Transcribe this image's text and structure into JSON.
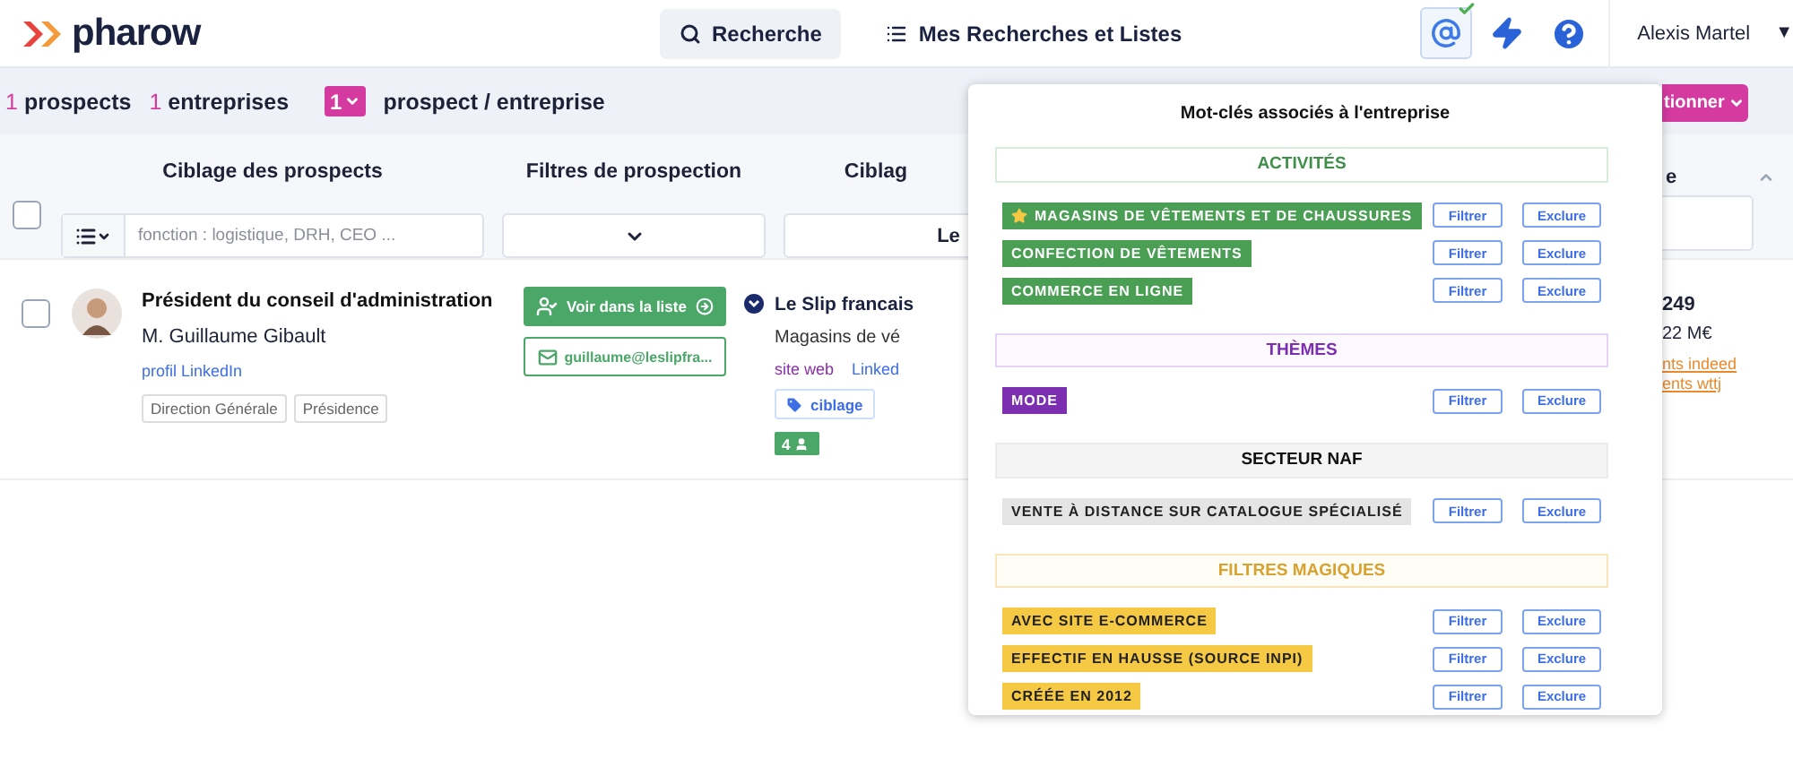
{
  "header": {
    "logo": "pharow",
    "nav": [
      {
        "label": "Recherche",
        "selected": true,
        "kind": "search"
      },
      {
        "label": "Mes Recherches et Listes",
        "selected": false,
        "kind": "list"
      }
    ],
    "user": "Alexis Martel",
    "user_caret": "▼"
  },
  "stats": {
    "counts": [
      {
        "count": "1",
        "label": "prospects"
      },
      {
        "count": "1",
        "label": "entreprises"
      }
    ],
    "per_company": {
      "value": "1",
      "label": "prospect / entreprise"
    },
    "action_button": "tionner"
  },
  "filters": {
    "select_all_checked": false,
    "columns": [
      {
        "title": "Ciblage des prospects",
        "kind": "text",
        "placeholder": "fonction : logistique, DRH, CEO ..."
      },
      {
        "title": "Filtres de prospection",
        "kind": "select"
      },
      {
        "title": "Ciblag",
        "kind": "partial",
        "value": "Le"
      }
    ],
    "right_column_title": "e"
  },
  "rows": [
    {
      "checked": false,
      "title": "Président du conseil d'administration",
      "name": "M. Guillaume Gibault",
      "linkedin": "profil LinkedIn",
      "tags": [
        "Direction Générale",
        "Présidence"
      ],
      "list_button": "Voir dans la liste",
      "email": "guillaume@leslipfra...",
      "company": {
        "name": "Le Slip francais",
        "activity": "Magasins de vé",
        "site": "site web",
        "linkedin": "Linked",
        "tag": "ciblage",
        "contacts": "4"
      },
      "right": {
        "figure": "249",
        "revenue": "22 M€",
        "links": [
          "nts indeed",
          "ents wttj"
        ]
      }
    }
  ],
  "popup": {
    "title": "Mot-clés associés à l'entreprise",
    "sections": [
      {
        "title": "ACTIVITÉS",
        "kind": "activities",
        "color": "#4a9f55",
        "items": [
          {
            "label": "MAGASINS DE VÊTEMENTS ET DE CHAUSSURES",
            "starred": true,
            "actions": [
              "Filtrer",
              "Exclure"
            ]
          },
          {
            "label": "CONFECTION DE VÊTEMENTS",
            "starred": false,
            "actions": [
              "Filtrer",
              "Exclure"
            ]
          },
          {
            "label": "COMMERCE EN LIGNE",
            "starred": false,
            "actions": [
              "Filtrer",
              "Exclure"
            ]
          }
        ]
      },
      {
        "title": "THÈMES",
        "kind": "themes",
        "color": "#7b2fb0",
        "items": [
          {
            "label": "MODE",
            "starred": false,
            "actions": [
              "Filtrer",
              "Exclure"
            ]
          }
        ]
      },
      {
        "title": "SECTEUR NAF",
        "kind": "naf",
        "color": "#e4e4e4",
        "items": [
          {
            "label": "VENTE À DISTANCE SUR CATALOGUE SPÉCIALISÉ",
            "starred": false,
            "actions": [
              "Filtrer",
              "Exclure"
            ]
          }
        ]
      },
      {
        "title": "FILTRES MAGIQUES",
        "kind": "magic",
        "color": "#f6c945",
        "items": [
          {
            "label": "AVEC SITE E-COMMERCE",
            "starred": false,
            "actions": [
              "Filtrer",
              "Exclure"
            ]
          },
          {
            "label": "EFFECTIF EN HAUSSE (SOURCE INPI)",
            "starred": false,
            "actions": [
              "Filtrer",
              "Exclure"
            ]
          },
          {
            "label": "CRÉÉE EN 2012",
            "starred": false,
            "actions": [
              "Filtrer",
              "Exclure"
            ]
          }
        ]
      }
    ]
  }
}
